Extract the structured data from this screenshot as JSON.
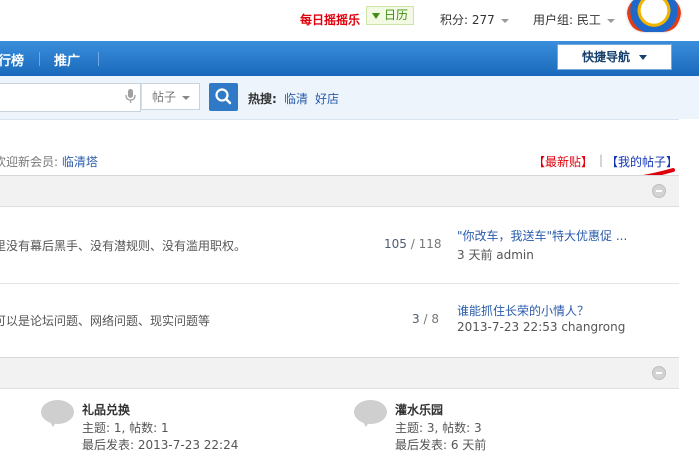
{
  "topbar": {
    "lottery_label": "每日摇摇乐",
    "calendar_label": "日历",
    "credits_label": "积分: 277",
    "usergroup_label": "用户组: 民工"
  },
  "nav": {
    "items": [
      {
        "label": "行榜"
      },
      {
        "label": "推广"
      }
    ],
    "quick_nav_label": "快捷导航"
  },
  "search": {
    "type_label": "帖子",
    "hot_label": "热搜:",
    "hot_links": [
      "临清",
      "好店"
    ]
  },
  "welcome": {
    "prefix": "欢迎新会员:",
    "member": "临清塔"
  },
  "links": {
    "latest": "【最新贴】",
    "separator": "|",
    "mine": "【我的帖子】"
  },
  "forums": [
    {
      "description": "里没有幕后黑手、没有潜规则、没有滥用职权。",
      "topics": "105",
      "posts": "118",
      "last_title": "\"你改车，我送车\"特大优惠促 ...",
      "last_meta": "3 天前 admin"
    },
    {
      "description": "可以是论坛问题、网络问题、现实问题等",
      "topics": "3",
      "posts": "8",
      "last_title": "谁能抓住长荣的小情人？",
      "last_meta": "2013-7-23 22:53 changrong"
    }
  ],
  "cards": [
    {
      "title": "礼品兑换",
      "stats": "主题: 1, 帖数: 1",
      "last": "最后发表: 2013-7-23 22:24"
    },
    {
      "title": "灌水乐园",
      "stats": "主题: 3, 帖数: 3",
      "last": "最后发表: 6 天前"
    }
  ],
  "colors": {
    "nav_blue": "#1a69bc",
    "lottery_red": "#e0000b",
    "link_blue": "#2a5cab"
  }
}
